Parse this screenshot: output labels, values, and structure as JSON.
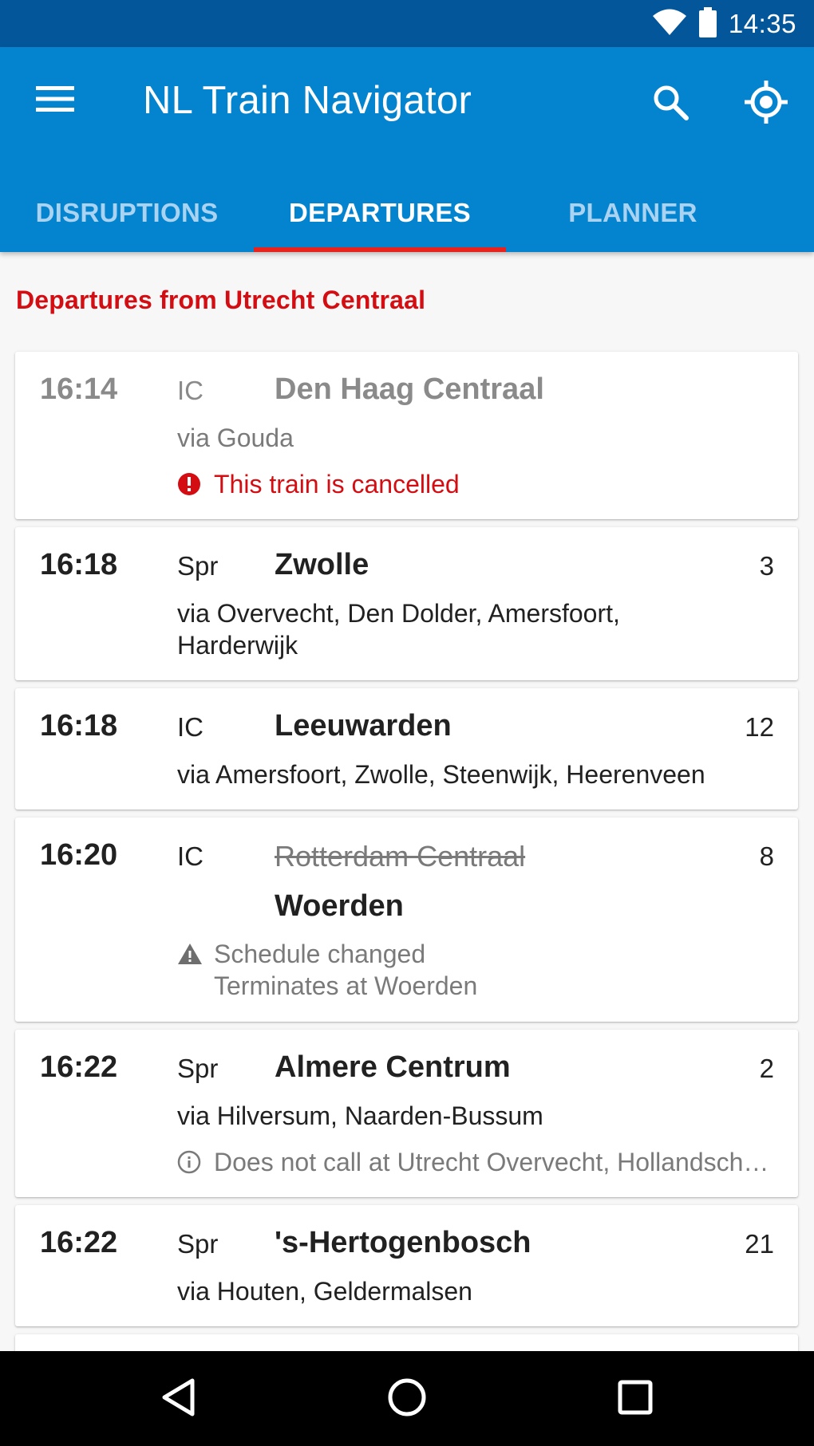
{
  "status_bar": {
    "time": "14:35",
    "icons": [
      "wifi-icon",
      "battery-icon"
    ]
  },
  "app_bar": {
    "title": "NL Train Navigator",
    "icons": [
      "menu-icon",
      "search-icon",
      "my-location-icon"
    ]
  },
  "tabs": [
    {
      "label": "DISRUPTIONS",
      "active": false
    },
    {
      "label": "DEPARTURES",
      "active": true
    },
    {
      "label": "PLANNER",
      "active": false
    }
  ],
  "section_heading": "Departures from Utrecht Centraal",
  "departures": [
    {
      "time": "16:14",
      "type": "IC",
      "destination": "Den Haag Centraal",
      "via": "via Gouda",
      "track": "",
      "notice": "This train is cancelled",
      "notice_icon": "error-icon",
      "cancelled": true
    },
    {
      "time": "16:18",
      "type": "Spr",
      "destination": "Zwolle",
      "via_line1": "via Overvecht, Den Dolder, Amersfoort,",
      "via_line2": "Harderwijk",
      "track": "3"
    },
    {
      "time": "16:18",
      "type": "IC",
      "destination": "Leeuwarden",
      "via": "via Amersfoort, Zwolle, Steenwijk, Heerenveen",
      "track": "12"
    },
    {
      "time": "16:20",
      "type": "IC",
      "original_destination": "Rotterdam Centraal",
      "destination": "Woerden",
      "track": "8",
      "notice_line1": "Schedule changed",
      "notice_line2": "Terminates at Woerden",
      "notice_icon": "warning-icon"
    },
    {
      "time": "16:22",
      "type": "Spr",
      "destination": "Almere Centrum",
      "via": "via Hilversum, Naarden-Bussum",
      "track": "2",
      "notice": "Does not call at Utrecht Overvecht, Hollandsche Rading",
      "notice_icon": "info-icon"
    },
    {
      "time": "16:22",
      "type": "Spr",
      "destination": "'s-Hertogenbosch",
      "via": "via Houten, Geldermalsen",
      "track": "21"
    }
  ],
  "nav_bar": {
    "icons": [
      "back-icon",
      "home-icon",
      "recents-icon"
    ]
  },
  "colors": {
    "status_bar": "#04569b",
    "app_bar": "#0483cf",
    "accent_red": "#d40d12",
    "tab_indicator": "#e8231e",
    "inactive_tab": "#a9d3f1"
  }
}
